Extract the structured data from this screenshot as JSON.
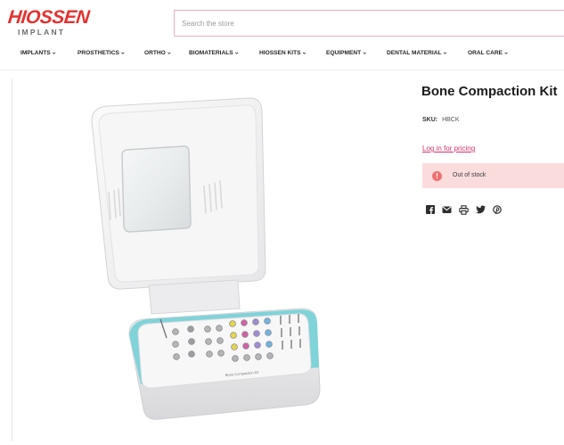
{
  "brand": {
    "name": "HIOSSEN",
    "sub": "IMPLANT",
    "color": "#e5322f"
  },
  "search": {
    "placeholder": "Search the store"
  },
  "nav": {
    "items": [
      {
        "label": "IMPLANTS"
      },
      {
        "label": "PROSTHETICS"
      },
      {
        "label": "ORTHO"
      },
      {
        "label": "BIOMATERIALS"
      },
      {
        "label": "HIOSSEN KITS"
      },
      {
        "label": "EQUIPMENT"
      },
      {
        "label": "DENTAL MATERIAL"
      },
      {
        "label": "ORAL CARE"
      }
    ]
  },
  "product": {
    "title": "Bone Compaction Kit",
    "sku_label": "SKU:",
    "sku_value": "HBCK",
    "pricing_link": "Log in for pricing",
    "stock_status": "Out of stock",
    "kit_label": "Bone Compaction Kit"
  },
  "share": {
    "icons": [
      "facebook-icon",
      "email-icon",
      "print-icon",
      "twitter-icon",
      "pinterest-icon"
    ]
  },
  "colors": {
    "accent": "#d32f6d",
    "stock_bg": "#fbdcdc",
    "stock_icon": "#ee7070",
    "case_rim": "#7fd3d9"
  }
}
